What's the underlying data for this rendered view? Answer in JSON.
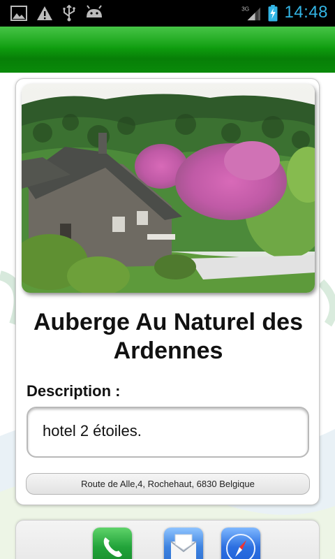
{
  "status_bar": {
    "time": "14:48",
    "network": "3G",
    "icons": [
      "image-icon",
      "warning-icon",
      "usb-icon",
      "android-debug-icon",
      "signal-icon",
      "battery-charging-icon"
    ]
  },
  "hotel": {
    "title": "Auberge Au Naturel des Ardennes",
    "photo_icon": "hotel-photo",
    "description_label": "Description :",
    "description": "hotel 2 étoiles.",
    "address": "Route de Alle,4, Rochehaut, 6830 Belgique"
  },
  "actions": [
    {
      "name": "call",
      "icon": "phone-icon",
      "color": "#1f9d2f"
    },
    {
      "name": "email",
      "icon": "mail-icon",
      "color": "#2d6fd0"
    },
    {
      "name": "website",
      "icon": "compass-icon",
      "color": "#1e5fd8"
    }
  ],
  "colors": {
    "action_bar": "#0f9e0f",
    "status_accent": "#33b5e5"
  }
}
